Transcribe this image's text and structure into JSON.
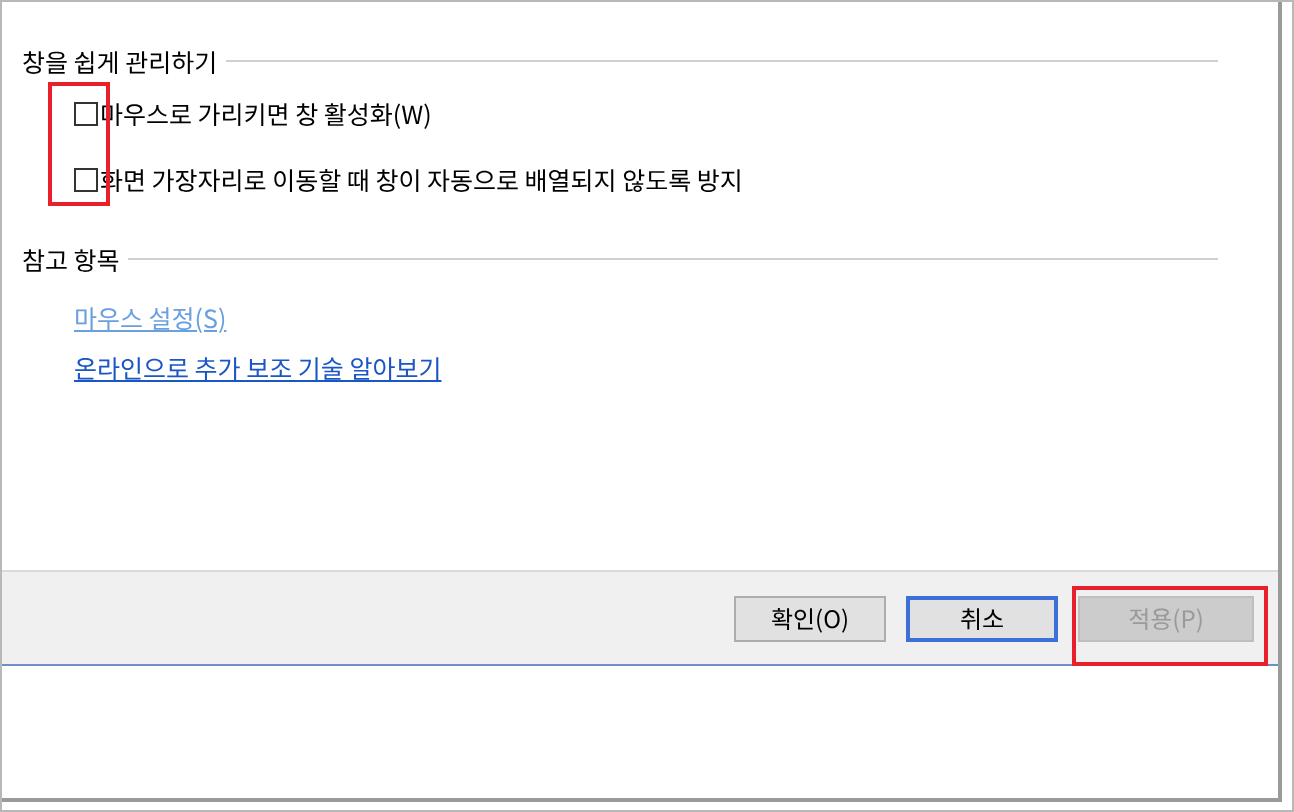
{
  "sections": [
    {
      "title": "창을 쉽게 관리하기",
      "kind": "checkboxes",
      "items": [
        {
          "label": "마우스로 가리키면 창 활성화(W)",
          "checked": false
        },
        {
          "label": "화면 가장자리로 이동할 때 창이 자동으로 배열되지 않도록 방지",
          "checked": false
        }
      ]
    },
    {
      "title": "참고 항목",
      "kind": "links",
      "items": [
        {
          "label": "마우스 설정(S)",
          "visited": true
        },
        {
          "label": "온라인으로 추가 보조 기술 알아보기",
          "visited": false
        }
      ]
    }
  ],
  "buttons": [
    {
      "label": "확인(O)",
      "default": false,
      "disabled": false
    },
    {
      "label": "취소",
      "default": true,
      "disabled": false
    },
    {
      "label": "적용(P)",
      "default": false,
      "disabled": true
    }
  ]
}
